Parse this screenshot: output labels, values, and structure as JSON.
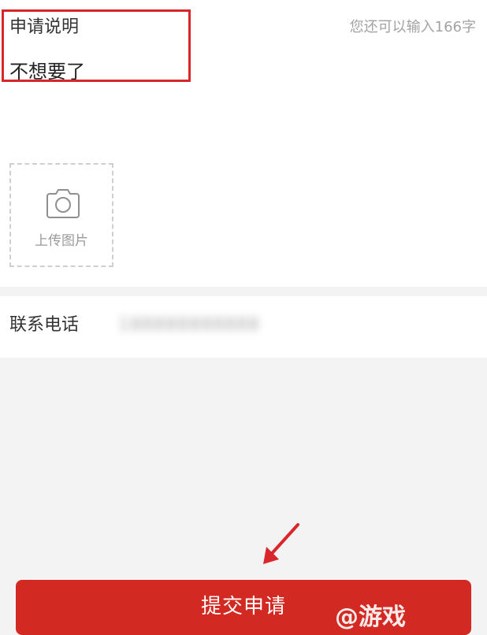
{
  "form": {
    "description_label": "申请说明",
    "remaining_text": "您还可以输入166字",
    "description_value": "不想要了"
  },
  "upload": {
    "label": "上传图片",
    "icon": "camera-icon"
  },
  "contact": {
    "label": "联系电话",
    "phone_value": "188888888888"
  },
  "actions": {
    "submit_label": "提交申请"
  },
  "annotation": {
    "highlight_color": "#d9262b",
    "arrow_color": "#d9262b"
  },
  "watermark": {
    "text": "@游戏"
  }
}
